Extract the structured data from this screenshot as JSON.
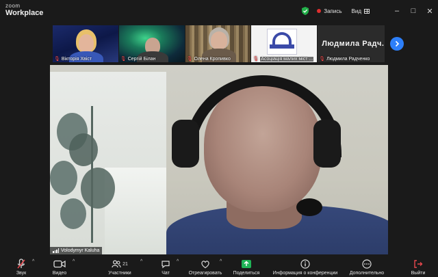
{
  "titlebar": {
    "brand_line1": "zoom",
    "brand_line2": "Workplace",
    "record_label": "Запись",
    "view_label": "Вид",
    "minimize": "–",
    "maximize": "□",
    "close": "✕"
  },
  "thumbnails": [
    {
      "name": "Вікторія Хвіст",
      "muted": true
    },
    {
      "name": "Сергій Білан",
      "muted": true
    },
    {
      "name": "Олена Кропивко",
      "muted": true
    },
    {
      "name": "Асоціація малих міст ...",
      "muted": true
    },
    {
      "name": "Людмила Радченко",
      "big_name": "Людмила  Радч...",
      "muted": true
    }
  ],
  "main_video": {
    "name": "Volodymyr Kaluha"
  },
  "toolbar": {
    "audio": "Звук",
    "video": "Видео",
    "participants": "Участники",
    "participants_count": "21",
    "chat": "Чат",
    "react": "Отреагировать",
    "share": "Поделиться",
    "info": "Информация о конференции",
    "more": "Дополнительно",
    "leave": "Выйти"
  },
  "colors": {
    "accent": "#2d7ff9",
    "share_green": "#1fb356",
    "record_red": "#e02f2f",
    "muted_red": "#ff4d4d",
    "leave_red": "#e8474d"
  }
}
